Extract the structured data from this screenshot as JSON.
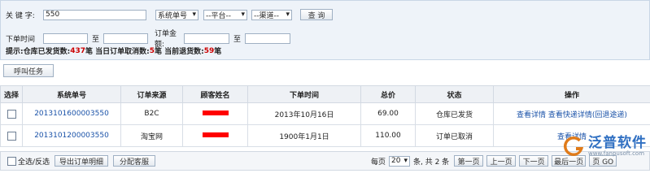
{
  "search": {
    "keyword_label": "关 键 字:",
    "keyword_value": "550",
    "field_select": "系统单号",
    "platform_select": "--平台--",
    "channel_select": "--渠道--",
    "query_button": "查 询",
    "order_time_label": "下单时间",
    "to1": "至",
    "amount_label": "订单金额:",
    "to2": "至"
  },
  "tip": {
    "prefix": "提示:仓库已发货数:",
    "shipped": "437",
    "unit1": "笔 当日订单取消数:",
    "cancelled": "5",
    "unit2": "笔 当前退货数:",
    "returned": "59",
    "unit3": "笔"
  },
  "call_task_button": "呼叫任务",
  "table": {
    "headers": [
      "选择",
      "系统单号",
      "订单来源",
      "顾客姓名",
      "下单时间",
      "总价",
      "状态",
      "操作"
    ],
    "rows": [
      {
        "order_no": "2013101600003550",
        "source": "B2C",
        "time": "2013年10月16日",
        "total": "69.00",
        "status": "仓库已发货",
        "actions": "查看详情 查看快递详情(回退途递)"
      },
      {
        "order_no": "2013101200003550",
        "source": "淘宝网",
        "time": "1900年1月1日",
        "total": "110.00",
        "status": "订单已取消",
        "actions": "查看详情"
      }
    ]
  },
  "footer": {
    "select_all": "全选/反选",
    "export_button": "导出订单明细",
    "assign_button": "分配客服",
    "per_page_label": "每页",
    "per_page_value": "20",
    "total_text": "条, 共 2 条",
    "first_button": "第一页",
    "prev_button": "上一页",
    "next_button": "下一页",
    "last_button": "最后一页",
    "go_button": "页 GO"
  },
  "watermark": {
    "brand": "泛普软件",
    "sub": "www.fanpusoft.com"
  },
  "colors": {
    "link": "#1a52a8",
    "red": "#cc0000",
    "panel": "#eef3f9"
  }
}
